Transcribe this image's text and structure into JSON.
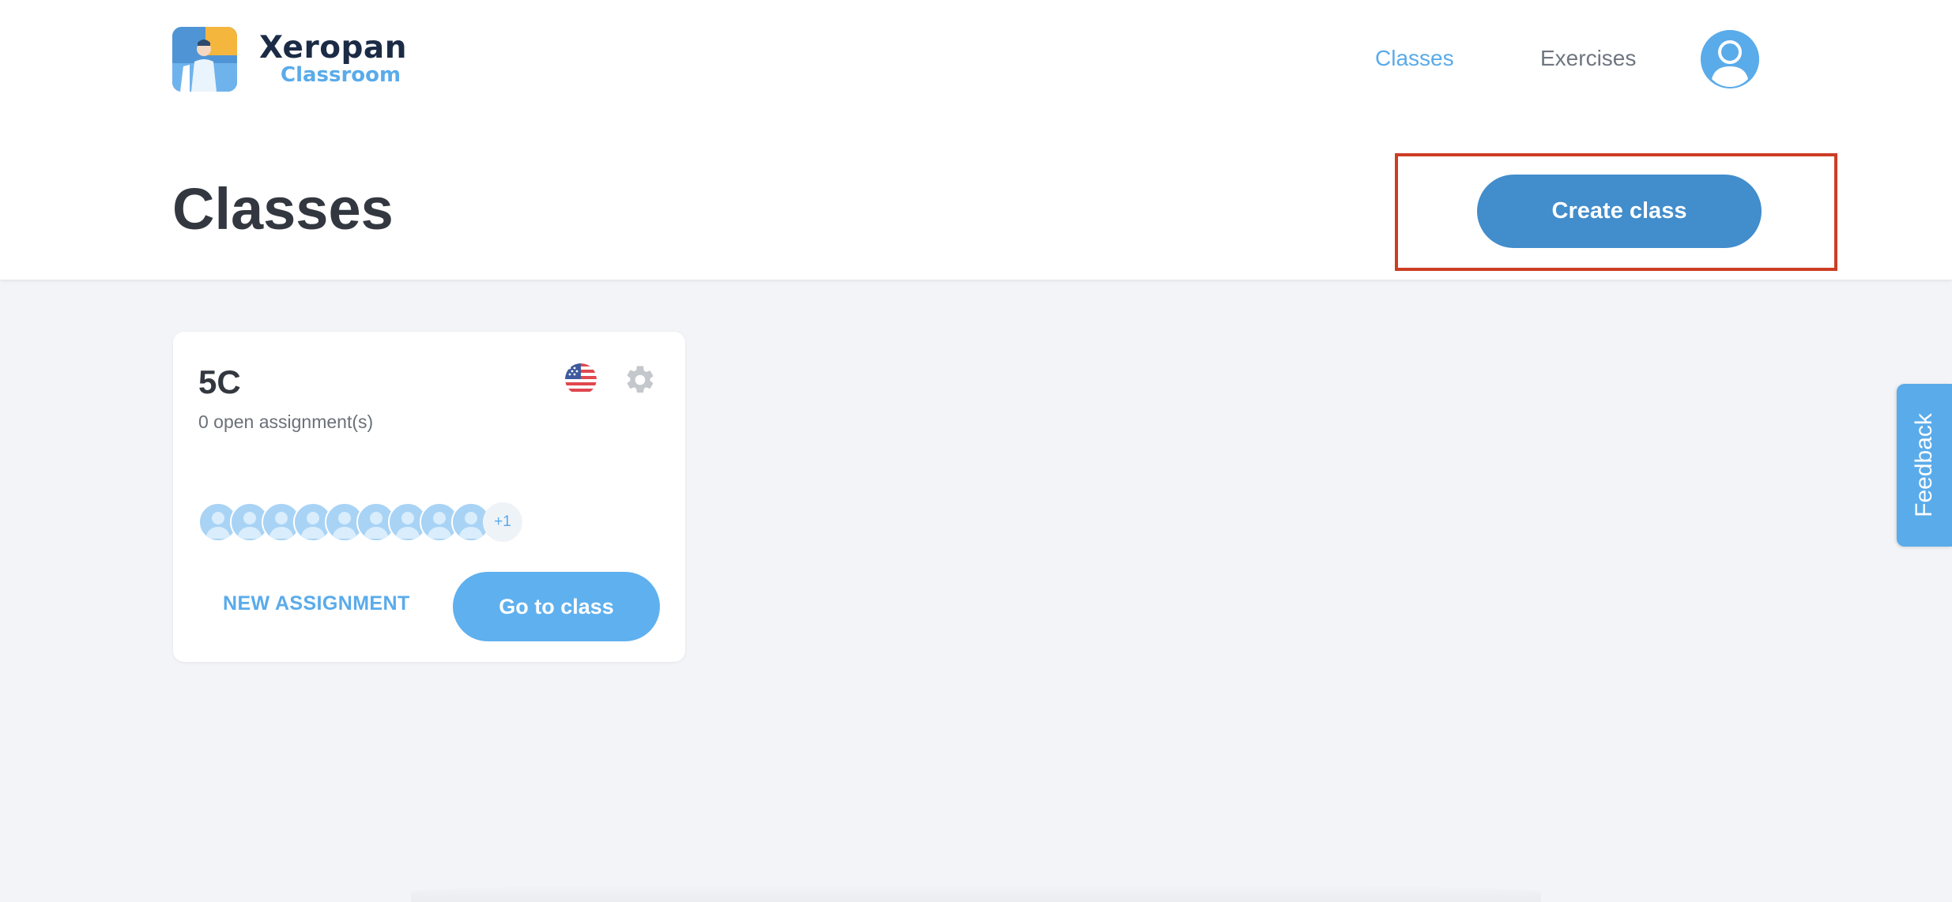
{
  "brand": {
    "name": "Xeropan",
    "product": "Classroom",
    "icon": "xeropan-logo-icon"
  },
  "nav": {
    "items": [
      {
        "label": "Classes",
        "active": true
      },
      {
        "label": "Exercises",
        "active": false
      }
    ],
    "profile_icon": "user-avatar-icon"
  },
  "page": {
    "title": "Classes",
    "create_button": "Create class"
  },
  "class_card": {
    "name": "5C",
    "subtitle": "0 open assignment(s)",
    "flag_icon": "us-flag-icon",
    "settings_icon": "gear-icon",
    "extra_students": "+1",
    "new_assignment": "NEW ASSIGNMENT",
    "go_button": "Go to class"
  },
  "feedback": {
    "label": "Feedback"
  },
  "colors": {
    "accent": "#5aabea",
    "primary_button": "#428dcc",
    "highlight": "#cc3d24",
    "title_text": "#333840",
    "background": "#f3f4f8"
  }
}
